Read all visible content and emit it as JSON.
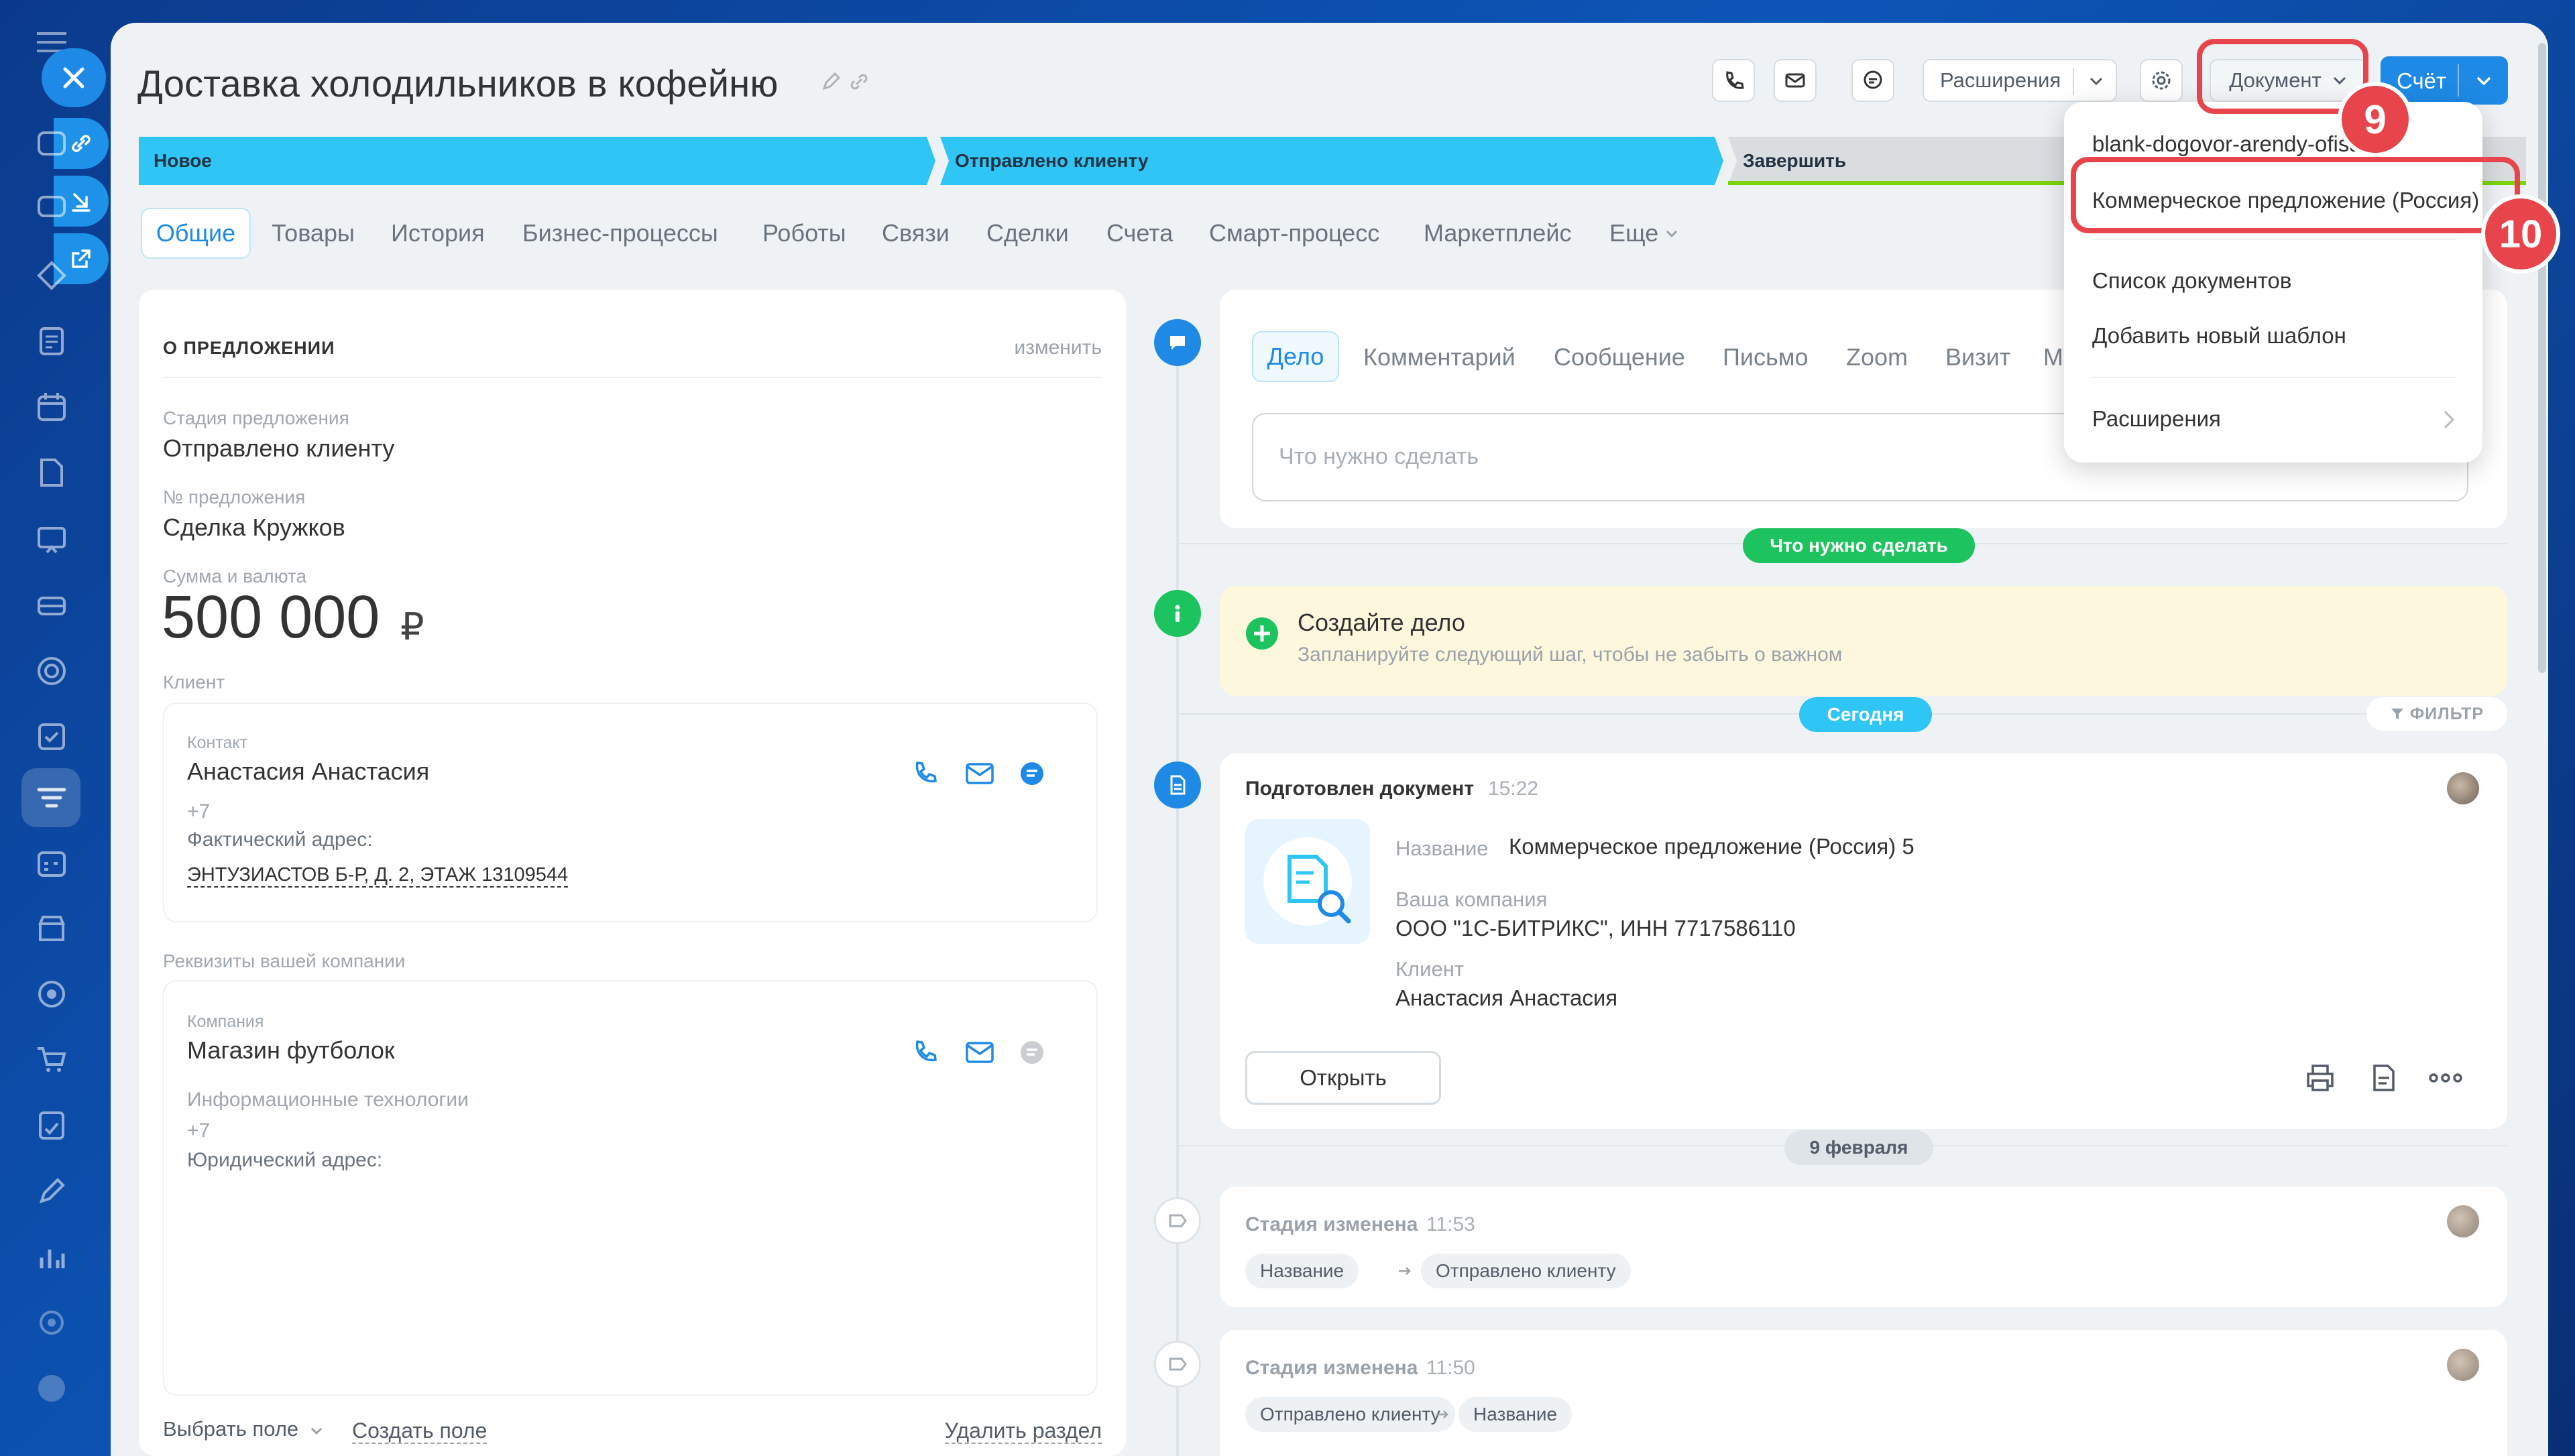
{
  "deal": {
    "title": "Доставка холодильников в кофейню"
  },
  "header": {
    "extensions": "Расширения",
    "document": "Документ",
    "invoice": "Счёт"
  },
  "stages": [
    "Новое",
    "Отправлено клиенту",
    "Завершить"
  ],
  "tabs": [
    "Общие",
    "Товары",
    "История",
    "Бизнес-процессы",
    "Роботы",
    "Связи",
    "Сделки",
    "Счета",
    "Смарт-процесс",
    "Маркетплейс",
    "Еще"
  ],
  "about": {
    "heading": "О ПРЕДЛОЖЕНИИ",
    "edit": "изменить",
    "stage_label": "Стадия предложения",
    "stage_value": "Отправлено клиенту",
    "number_label": "№ предложения",
    "number_value": "Сделка Кружков",
    "sum_label": "Сумма и валюта",
    "sum_value": "500 000",
    "currency": "₽",
    "client_label": "Клиент",
    "contact_label": "Контакт",
    "contact_name": "Анастасия Анастасия",
    "contact_phone": "+7",
    "address_label": "Фактический адрес:",
    "address_value": "ЭНТУЗИАСТОВ Б-Р, Д. 2, ЭТАЖ 13109544",
    "requisites_label": "Реквизиты вашей компании",
    "company_label": "Компания",
    "company_name": "Магазин футболок",
    "company_industry": "Информационные технологии",
    "company_phone": "+7",
    "legal_address_label": "Юридический адрес:",
    "select_field": "Выбрать поле",
    "create_field": "Создать поле",
    "delete_section": "Удалить раздел"
  },
  "activity": {
    "tabs": [
      "Дело",
      "Комментарий",
      "Сообщение",
      "Письмо",
      "Zoom",
      "Визит",
      "М"
    ],
    "placeholder": "Что нужно сделать",
    "todo_pill": "Что нужно сделать",
    "create_title": "Создайте дело",
    "create_sub": "Запланируйте следующий шаг, чтобы не забыть о важном",
    "today_pill": "Сегодня",
    "filter": "ФИЛЬТР",
    "doc_title": "Подготовлен документ",
    "doc_time": "15:22",
    "doc_name_label": "Название",
    "doc_name": "Коммерческое предложение (Россия) 5",
    "doc_company_label": "Ваша компания",
    "doc_company": "ООО \"1С-БИТРИКС\", ИНН 7717586110",
    "doc_client_label": "Клиент",
    "doc_client": "Анастасия Анастасия",
    "open_btn": "Открыть",
    "date_pill": "9 февраля",
    "ev1_title": "Стадия изменена",
    "ev1_time": "11:53",
    "ev1_from": "Название",
    "ev1_to": "Отправлено клиенту",
    "ev2_title": "Стадия изменена",
    "ev2_time": "11:50",
    "ev2_from": "Отправлено клиенту",
    "ev2_to": "Название"
  },
  "dropdown": {
    "items": [
      "blank-dogovor-arendy-ofisa",
      "Коммерческое предложение (Россия)",
      "Список документов",
      "Добавить новый шаблон",
      "Расширения"
    ]
  },
  "annotations": {
    "step9": "9",
    "step10": "10"
  },
  "colors": {
    "accent": "#2fc6f6",
    "primary": "#1e8ae6",
    "success": "#1cc35e",
    "todo_bg": "#fdf8dd",
    "annotation": "#e7444b"
  }
}
